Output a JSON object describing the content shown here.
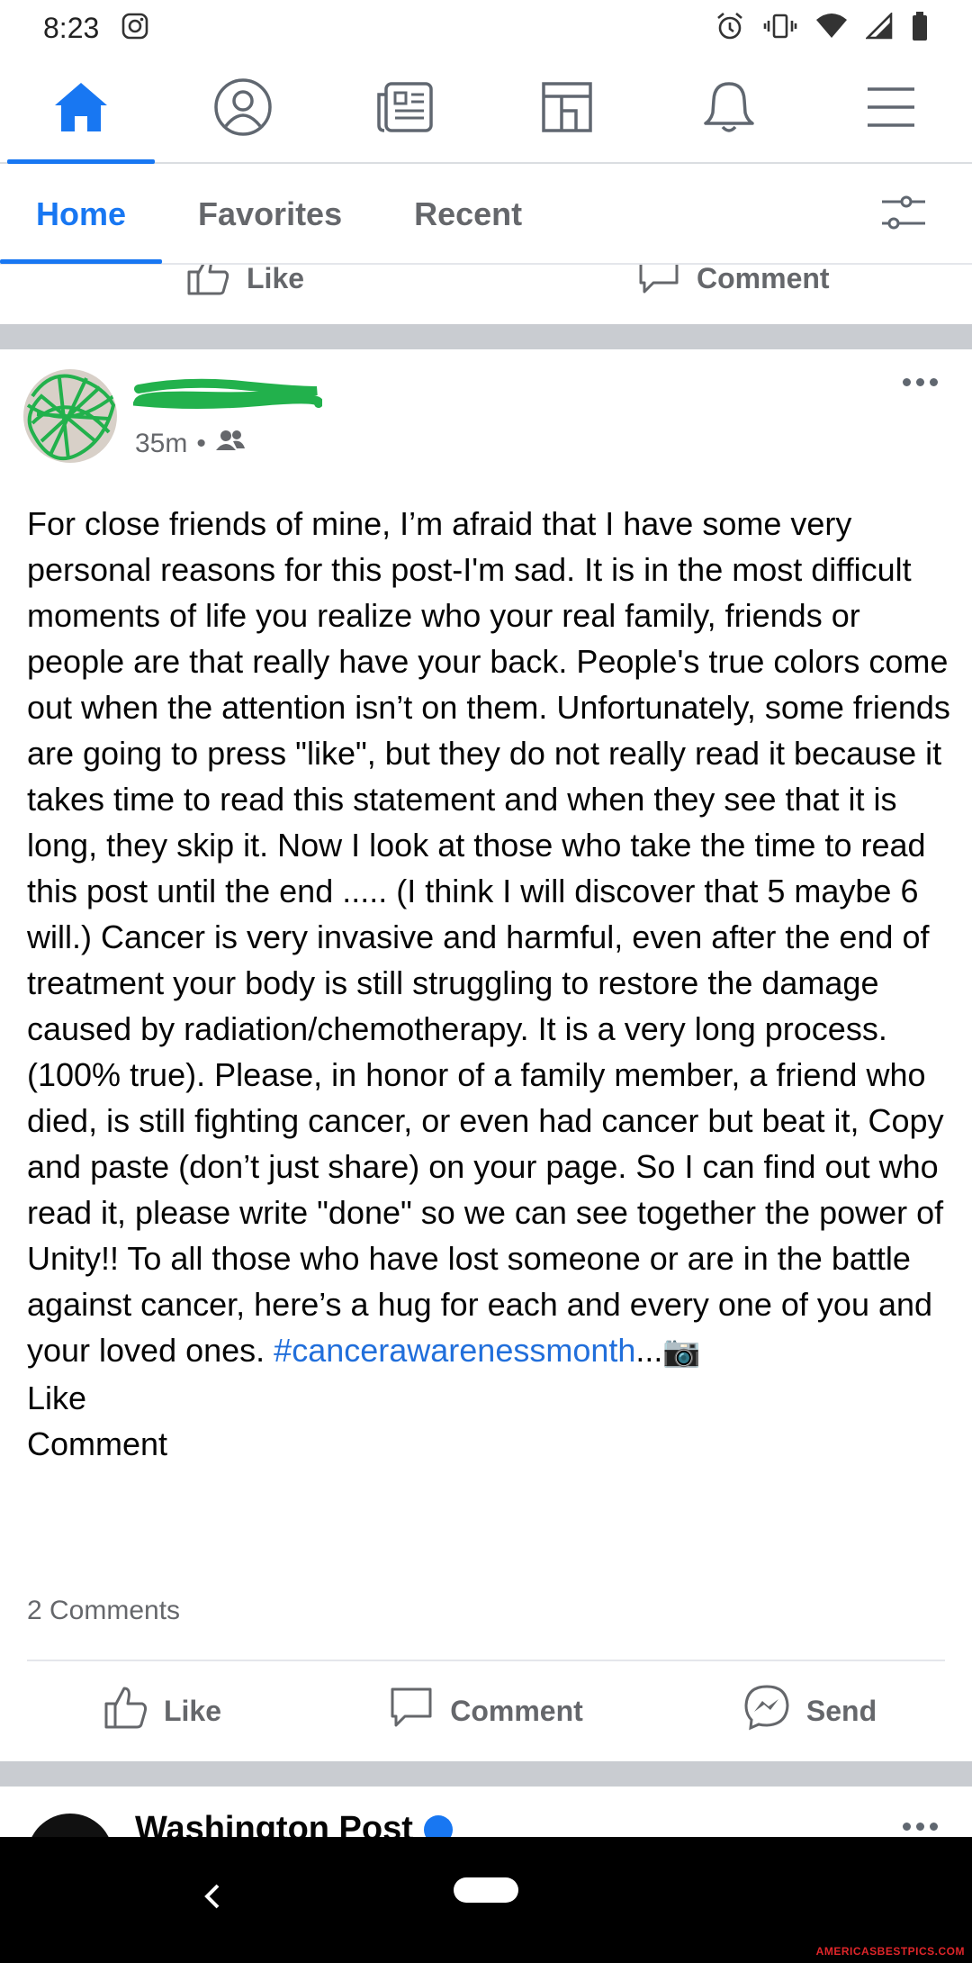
{
  "status_bar": {
    "time": "8:23"
  },
  "top_nav": {
    "items": [
      {
        "icon": "home-icon",
        "active": true
      },
      {
        "icon": "profile-icon",
        "active": false
      },
      {
        "icon": "news-icon",
        "active": false
      },
      {
        "icon": "pages-icon",
        "active": false
      },
      {
        "icon": "bell-icon",
        "active": false
      },
      {
        "icon": "menu-icon",
        "active": false
      }
    ]
  },
  "feed_tabs": {
    "tabs": [
      {
        "label": "Home",
        "active": true
      },
      {
        "label": "Favorites",
        "active": false
      },
      {
        "label": "Recent",
        "active": false
      }
    ]
  },
  "prev_post": {
    "like_label": "Like",
    "comment_label": "Comment"
  },
  "post": {
    "time": "35m",
    "audience_icon": "friends-icon",
    "body": "For close friends of mine, I’m afraid that I have some very personal reasons for this post-I'm sad. It is in the most difficult moments of life you realize who your real family, friends or people are that really have your back. People's true colors come out when the attention isn’t on them. Unfortunately, some friends are going to press \"like\", but they do not really read it because it takes time to read this statement and when they see that it is long, they skip it. Now I look at those who take the time to read this post until the end ..... (I think I will discover that 5 maybe 6 will.) Cancer is very invasive and harmful, even after the end of treatment your body is still struggling to restore the damage caused by radiation/chemotherapy. It is a very long process. (100% true). Please, in honor of a family member, a friend who died, is still fighting cancer, or even had cancer but beat it, Copy and paste (don’t just share) on your page. So I can find out who read it, please write \"done\" so we can see together the power of Unity!! To all those who have lost someone or are in the battle against cancer, here’s a hug for each and every one of you and your loved ones. ",
    "hashtag": "#cancerawarenessmonth",
    "ellipsis": "...",
    "camera_emoji": "📷",
    "extra_line_1": "Like",
    "extra_line_2": "Comment",
    "comments_count": "2 Comments",
    "actions": {
      "like": "Like",
      "comment": "Comment",
      "send": "Send"
    }
  },
  "next_post": {
    "author": "Washington Post"
  },
  "watermark": "AMERICASBESTPICS.COM",
  "colors": {
    "accent": "#1877f2",
    "hashtag": "#216fdb",
    "separator": "#c9ccd1",
    "scribble": "#22b14c"
  }
}
